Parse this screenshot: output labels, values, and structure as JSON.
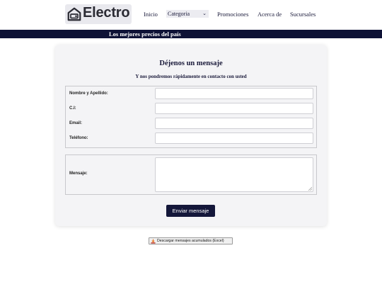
{
  "header": {
    "logo_text": "Electro",
    "nav": {
      "inicio": "Inicio",
      "categoria": "Categoria",
      "promociones": "Promociones",
      "acerca": "Acerca de",
      "sucursales": "Sucursales"
    }
  },
  "banner": {
    "text": "Los mejores precios del país"
  },
  "form": {
    "title": "Déjenos un mensaje",
    "subtitle": "Y nos pondremos rápidamente en contacto con usted",
    "labels": {
      "nombre": "Nombre y Apellido:",
      "ci": "C.I:",
      "email": "Email:",
      "telefono": "Teléfono:",
      "mensaje": "Mensaje:"
    },
    "values": {
      "nombre": "",
      "ci": "",
      "email": "",
      "telefono": "",
      "mensaje": ""
    },
    "submit_label": "Enviar mensaje"
  },
  "download_label": "Descargar mensajes acumulados (Excel)",
  "colors": {
    "navy": "#0e1236",
    "button": "#14173a",
    "card_bg": "#f4f4f6"
  }
}
